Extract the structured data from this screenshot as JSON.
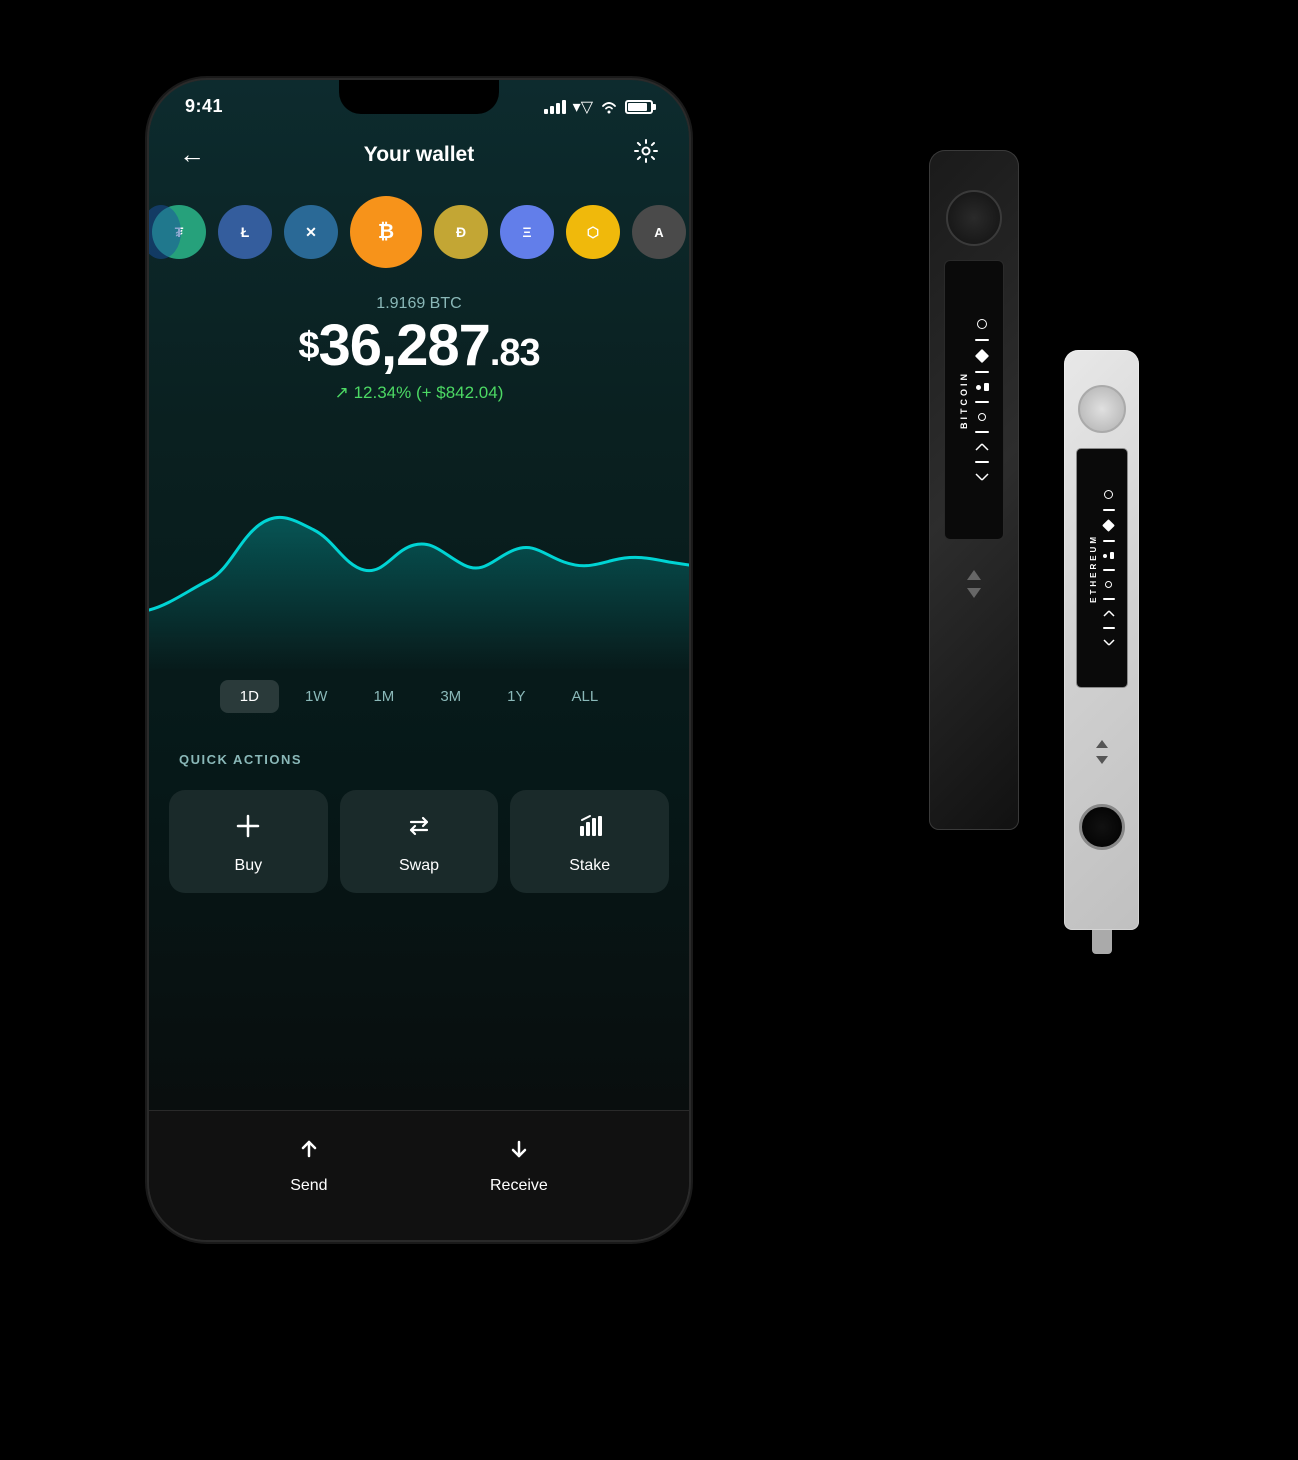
{
  "status": {
    "time": "9:41",
    "battery_level": 85
  },
  "header": {
    "title": "Your wallet",
    "back_label": "←",
    "settings_label": "⚙"
  },
  "coins": [
    {
      "id": "partial",
      "symbol": "",
      "class": "coin-partial-left"
    },
    {
      "id": "usdt",
      "symbol": "₮",
      "class": "coin-usdt"
    },
    {
      "id": "ltc",
      "symbol": "Ł",
      "class": "coin-ltc"
    },
    {
      "id": "xrp",
      "symbol": "✕",
      "class": "coin-xrp"
    },
    {
      "id": "btc",
      "symbol": "₿",
      "class": "coin-btc",
      "active": true
    },
    {
      "id": "doge",
      "symbol": "Ð",
      "class": "coin-doge"
    },
    {
      "id": "eth",
      "symbol": "Ξ",
      "class": "coin-eth"
    },
    {
      "id": "bnb",
      "symbol": "⬡",
      "class": "coin-bnb"
    },
    {
      "id": "algo",
      "symbol": "A",
      "class": "coin-algo"
    }
  ],
  "balance": {
    "crypto_amount": "1.9169 BTC",
    "currency_symbol": "$",
    "amount_main": "36,287",
    "amount_cents": ".83",
    "change_percent": "12.34%",
    "change_amount": "+ $842.04",
    "change_label": "↗ 12.34% (+ $842.04)"
  },
  "chart": {
    "time_filters": [
      "1D",
      "1W",
      "1M",
      "3M",
      "1Y",
      "ALL"
    ],
    "active_filter": "1D"
  },
  "quick_actions": {
    "label": "QUICK ACTIONS",
    "buttons": [
      {
        "id": "buy",
        "icon": "+",
        "label": "Buy"
      },
      {
        "id": "swap",
        "icon": "⇄",
        "label": "Swap"
      },
      {
        "id": "stake",
        "icon": "↑↑",
        "label": "Stake"
      }
    ]
  },
  "bottom_actions": {
    "buttons": [
      {
        "id": "send",
        "icon": "↑",
        "label": "Send"
      },
      {
        "id": "receive",
        "icon": "↓",
        "label": "Receive"
      }
    ]
  },
  "ledger_devices": {
    "nano_x_label": "Bitcoin",
    "nano_s_label": "Ethereum"
  }
}
